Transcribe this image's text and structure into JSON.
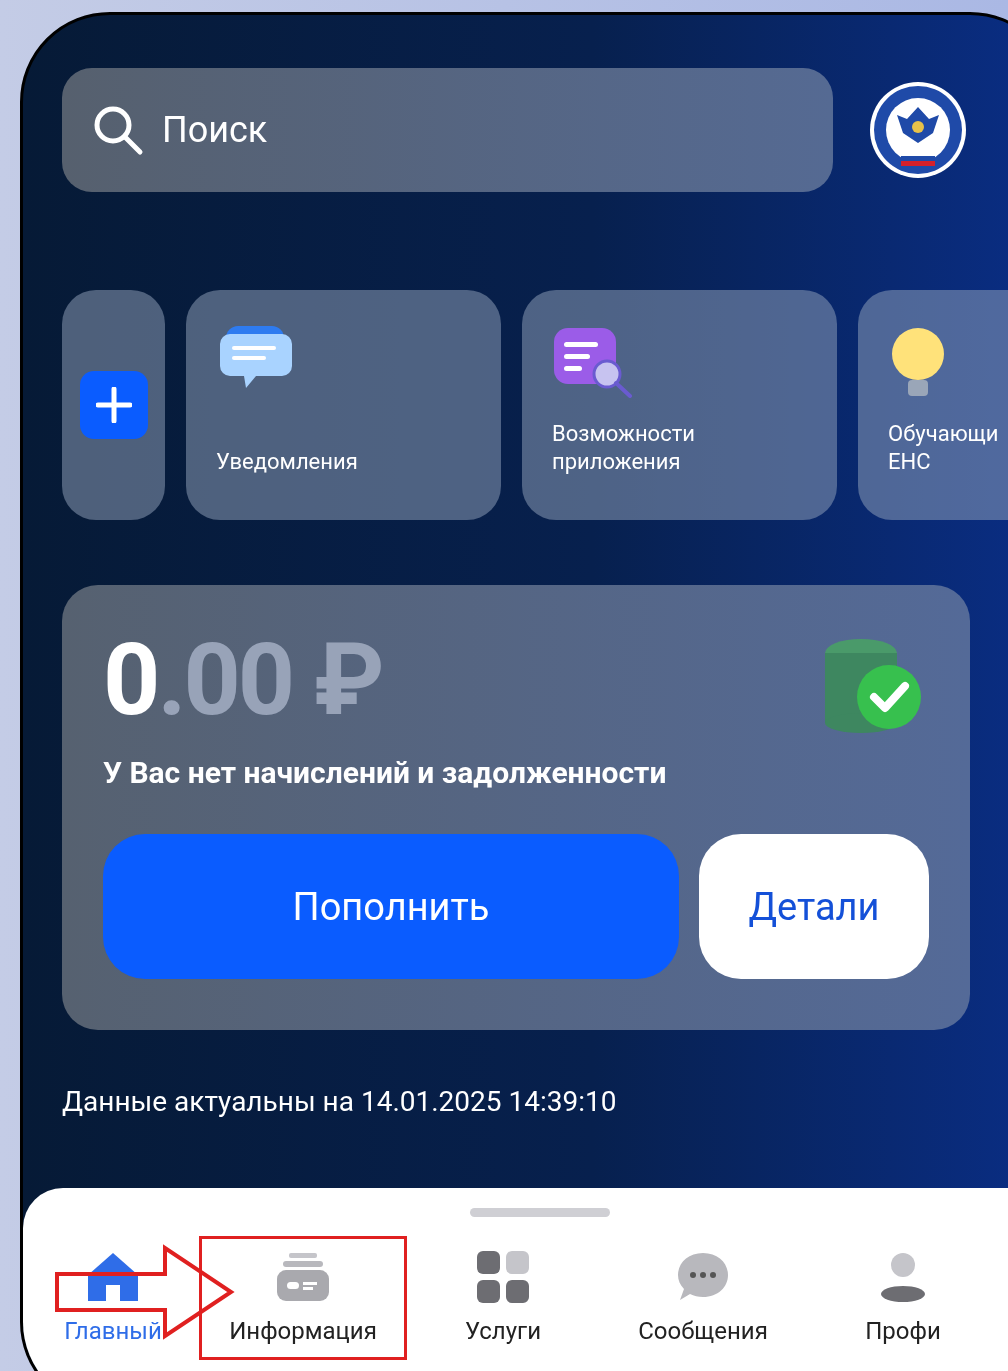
{
  "search": {
    "placeholder": "Поиск"
  },
  "shortcuts": [
    {
      "kind": "add"
    },
    {
      "kind": "chat",
      "label": "Уведомления"
    },
    {
      "kind": "document-search",
      "label": "Возможности приложения"
    },
    {
      "kind": "bulb",
      "label": "Обучающи ЕНС"
    }
  ],
  "balance": {
    "whole": "0",
    "fraction": ".00",
    "currency": "₽",
    "message": "У Вас нет начислений и задолженности",
    "primary_button": "Пополнить",
    "secondary_button": "Детали"
  },
  "updated": "Данные актуальны на 14.01.2025 14:39:10",
  "nav": [
    {
      "kind": "home",
      "label": "Главный",
      "selected": true,
      "annotated": false
    },
    {
      "kind": "info",
      "label": "Информация",
      "selected": false,
      "annotated": true
    },
    {
      "kind": "services",
      "label": "Услуги",
      "selected": false,
      "annotated": false
    },
    {
      "kind": "messages",
      "label": "Сообщения",
      "selected": false,
      "annotated": false
    },
    {
      "kind": "profile",
      "label": "Профи",
      "selected": false,
      "annotated": false
    }
  ]
}
